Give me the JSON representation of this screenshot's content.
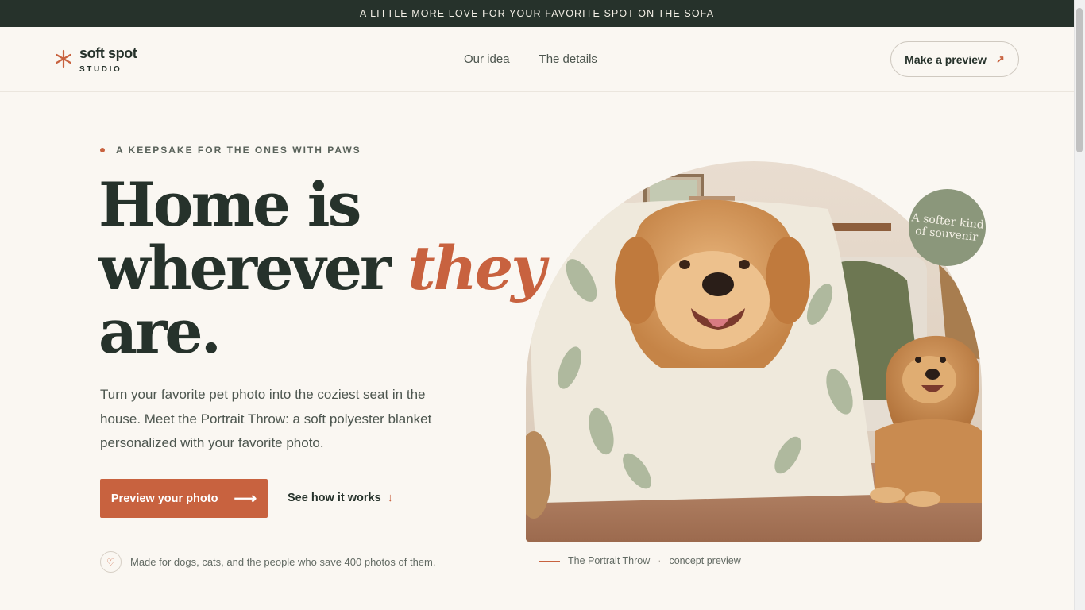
{
  "announcement": "A LITTLE MORE LOVE FOR YOUR FAVORITE SPOT ON THE SOFA",
  "brand": {
    "name": "soft spot",
    "sub": "STUDIO",
    "accent": "#c8623f"
  },
  "nav": {
    "links": [
      "Our idea",
      "The details"
    ],
    "cta_label": "Make a preview",
    "cta_icon": "arrow-up-right-icon"
  },
  "hero": {
    "eyebrow": "A KEEPSAKE FOR THE ONES WITH PAWS",
    "headline": {
      "line1": "Home is",
      "line2_plain": "wherever",
      "line2_accent": "they",
      "line3": "are."
    },
    "lede": "Turn your favorite pet photo into the coziest seat in the house. Meet the Portrait Throw: a soft polyester blanket personalized with your favorite photo.",
    "primary_cta": "Preview your photo",
    "secondary_cta": "See how it works",
    "note": "Made for dogs, cats, and the people who save 400 photos of them."
  },
  "visual": {
    "badge": "A softer kind of souvenir",
    "caption_title": "The Portrait Throw",
    "caption_sep": "·",
    "caption_sub": "concept preview"
  },
  "colors": {
    "dark": "#26322b",
    "terracotta": "#c8623f",
    "sage": "#8b977b",
    "background": "#faf7f2"
  }
}
